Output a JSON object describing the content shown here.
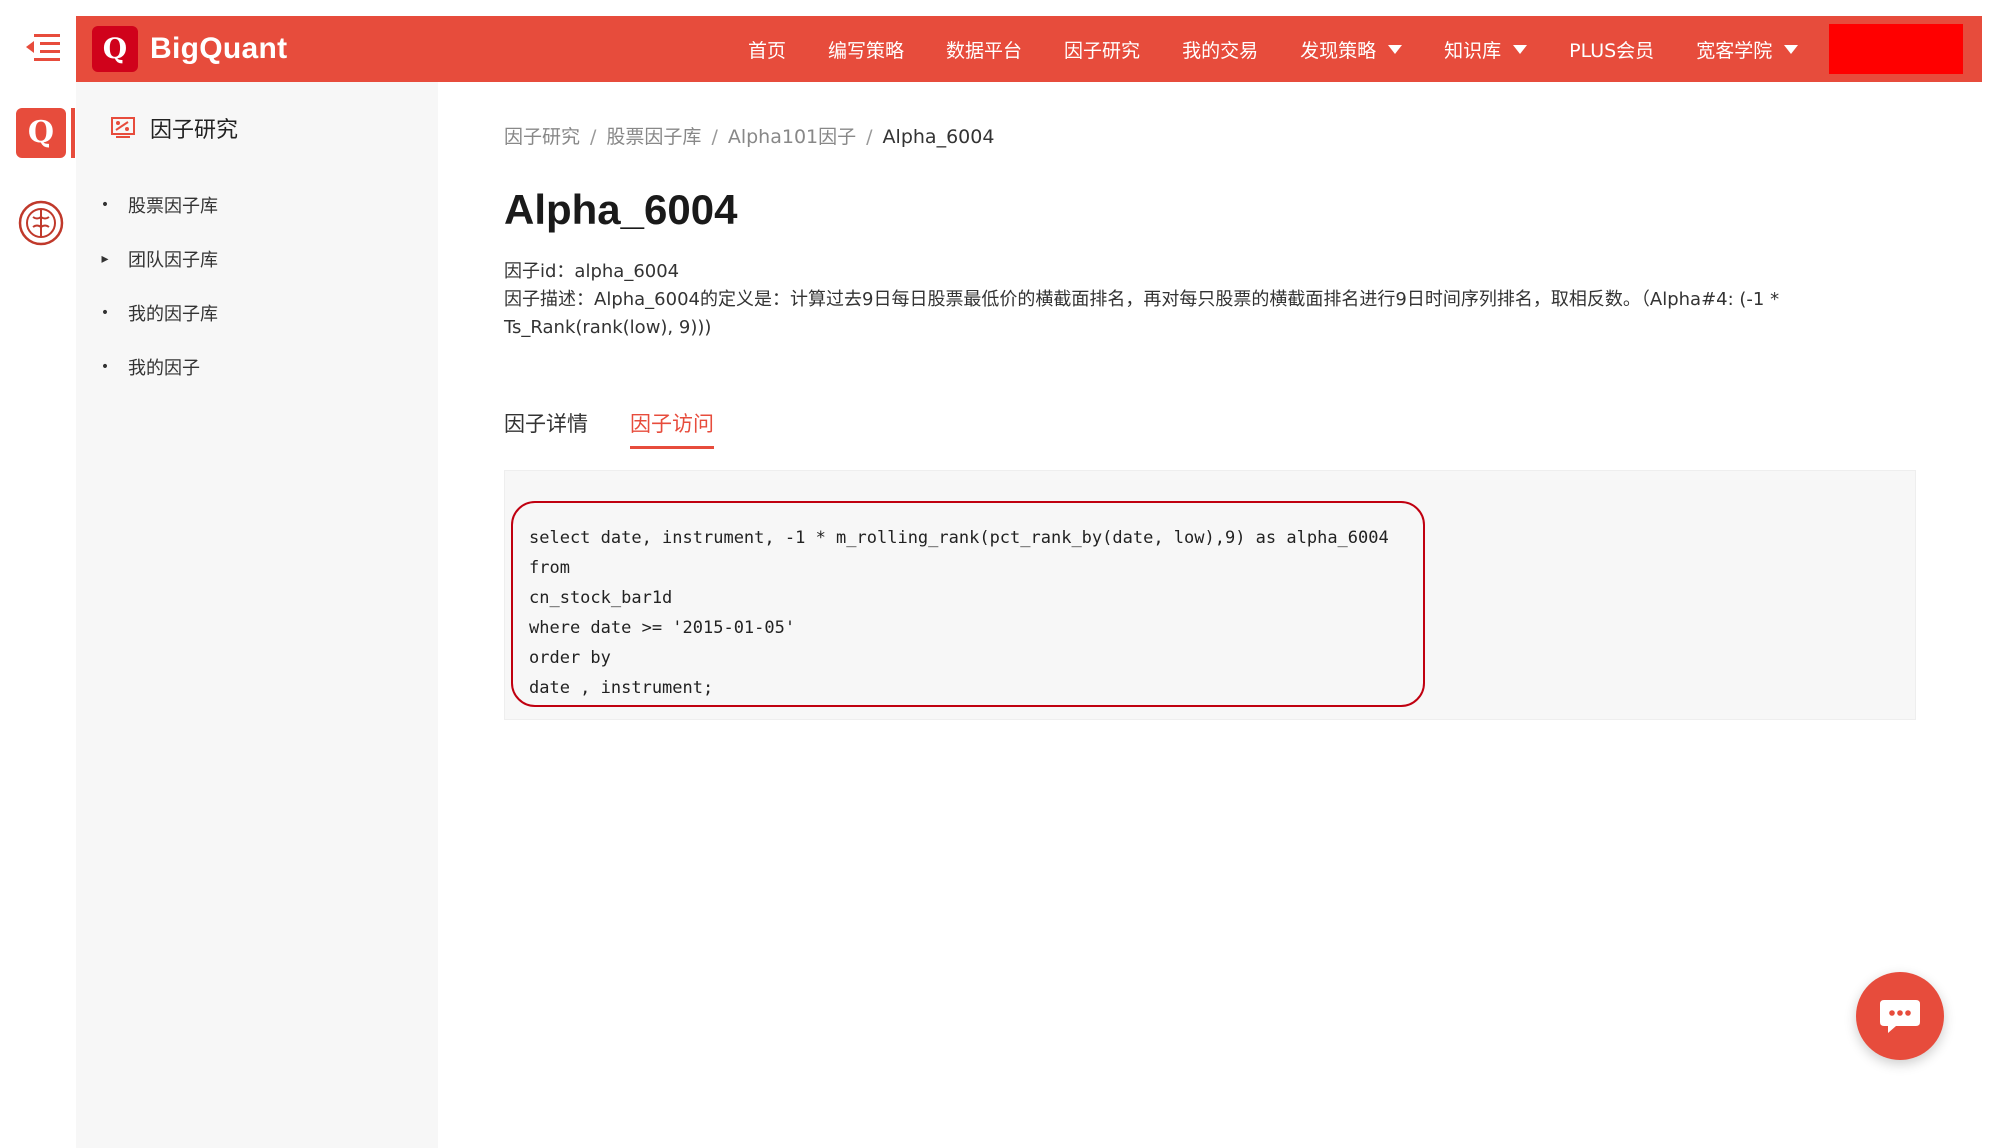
{
  "brand": {
    "name": "BigQuant",
    "mark": "Q",
    "color": "#e74c3c"
  },
  "nav": {
    "items": [
      {
        "label": "首页",
        "dropdown": false
      },
      {
        "label": "编写策略",
        "dropdown": false
      },
      {
        "label": "数据平台",
        "dropdown": false
      },
      {
        "label": "因子研究",
        "dropdown": false
      },
      {
        "label": "我的交易",
        "dropdown": false
      },
      {
        "label": "发现策略",
        "dropdown": true
      },
      {
        "label": "知识库",
        "dropdown": true
      },
      {
        "label": "PLUS会员",
        "dropdown": false
      },
      {
        "label": "宽客学院",
        "dropdown": true
      }
    ]
  },
  "rail": {
    "logo": "Q",
    "icons": [
      "menu-icon",
      "brain-icon"
    ]
  },
  "sidebar": {
    "title": "因子研究",
    "items": [
      {
        "label": "股票因子库",
        "bullet": "•"
      },
      {
        "label": "团队因子库",
        "bullet": "▸"
      },
      {
        "label": "我的因子库",
        "bullet": "•"
      },
      {
        "label": "我的因子",
        "bullet": "•"
      }
    ]
  },
  "breadcrumb": {
    "items": [
      "因子研究",
      "股票因子库",
      "Alpha101因子"
    ],
    "current": "Alpha_6004",
    "separator": "/"
  },
  "factor": {
    "title": "Alpha_6004",
    "id_line": "因子id：alpha_6004",
    "desc_line": "因子描述：Alpha_6004的定义是：计算过去9日每日股票最低价的横截面排名，再对每只股票的横截面排名进行9日时间序列排名，取相反数。（Alpha#4: (-1 * Ts_Rank(rank(low), 9)))"
  },
  "tabs": [
    {
      "label": "因子详情",
      "active": false
    },
    {
      "label": "因子访问",
      "active": true
    }
  ],
  "code": {
    "lines": [
      "select date, instrument, -1 * m_rolling_rank(pct_rank_by(date, low),9) as alpha_6004",
      "from",
      "cn_stock_bar1d",
      "where date >= '2015-01-05'",
      "order by",
      "date , instrument;"
    ]
  }
}
